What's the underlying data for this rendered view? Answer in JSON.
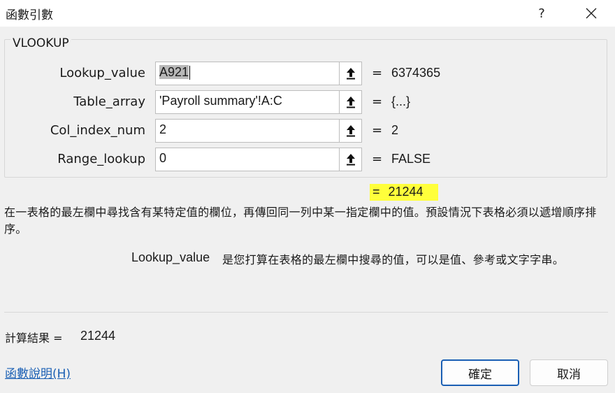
{
  "window": {
    "title": "函數引數",
    "help": "?",
    "close": "close-icon"
  },
  "function": {
    "name": "VLOOKUP",
    "args": [
      {
        "label": "Lookup_value",
        "value": "A921",
        "result": "6374365"
      },
      {
        "label": "Table_array",
        "value": "'Payroll  summary'!A:C",
        "result": "{...}"
      },
      {
        "label": "Col_index_num",
        "value": "2",
        "result": "2"
      },
      {
        "label": "Range_lookup",
        "value": "0",
        "result": "FALSE"
      }
    ],
    "eq": "=",
    "formula_result": "21244",
    "description": "在一表格的最左欄中尋找含有某特定值的欄位，再傳回同一列中某一指定欄中的值。預設情況下表格必須以遞增順序排序。",
    "arg_help_name": "Lookup_value",
    "arg_help_text": "是您打算在表格的最左欄中搜尋的值，可以是值、參考或文字字串。"
  },
  "footer": {
    "calc_label": "計算結果 =",
    "calc_value": "21244",
    "help_link": "函數說明(H)",
    "ok": "確定",
    "cancel": "取消"
  },
  "highlight_color": "#ffff3b"
}
